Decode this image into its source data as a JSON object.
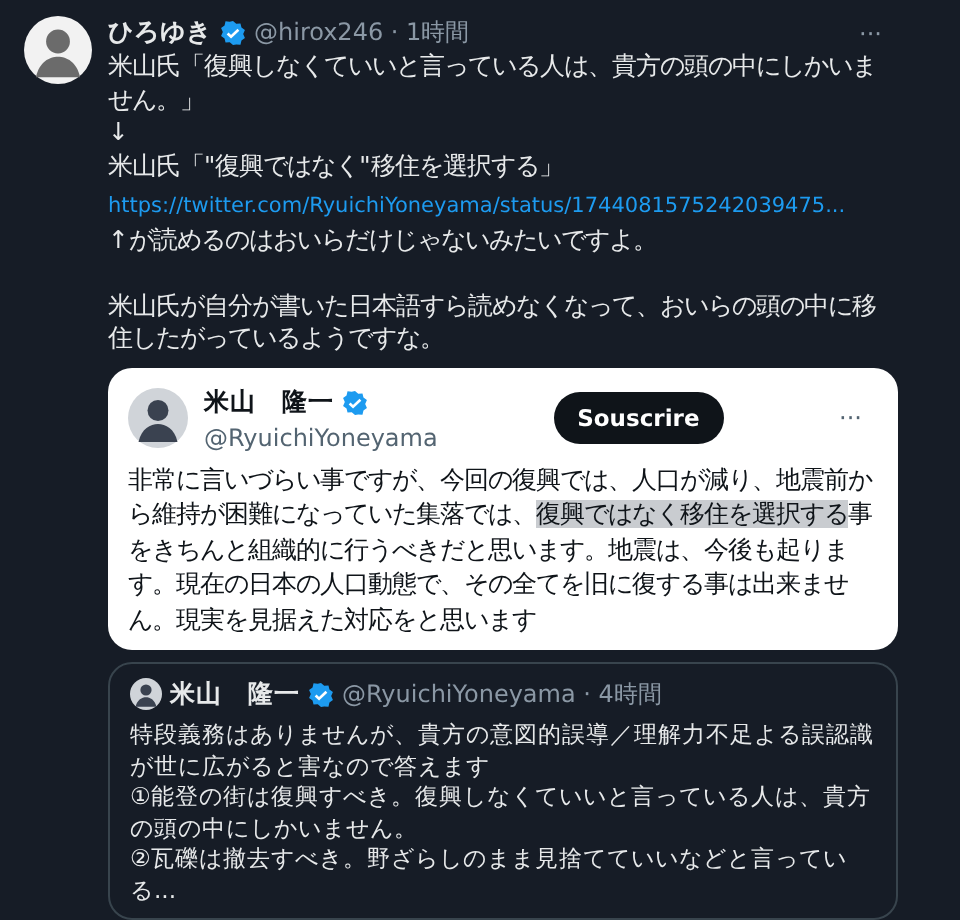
{
  "tweet": {
    "author": "ひろゆき",
    "verified": true,
    "handle": "@hirox246 · 1時間",
    "more": "···",
    "lines": [
      {
        "kind": "text",
        "text": "米山氏「復興しなくていいと言っている人は、貴方の頭の中にしかいません。」"
      },
      {
        "kind": "text",
        "text": "↓"
      },
      {
        "kind": "text",
        "text": "米山氏「\"復興ではなく\"移住を選択する」"
      },
      {
        "kind": "link",
        "text": "https://twitter.com/RyuichiYoneyama/status/1744081575242039475..."
      },
      {
        "kind": "text",
        "text": "↑が読めるのはおいらだけじゃないみたいですよ。"
      },
      {
        "kind": "blank"
      },
      {
        "kind": "text",
        "text": "米山氏が自分が書いた日本語すら読めなくなって、おいらの頭の中に移住したがっているようですな。"
      }
    ]
  },
  "embedded_post": {
    "author": "米山　隆一",
    "verified": true,
    "handle": "@RyuichiYoneyama",
    "button": "Souscrire",
    "more": "···",
    "segments": [
      {
        "text": "非常に言いづらい事ですが、今回の復興では、人口が減り、地震前から維持が困難になっていた集落では、",
        "highlighted": false
      },
      {
        "text": "復興ではなく移住を選択する",
        "highlighted": true
      },
      {
        "text": "事をきちんと組織的に行うべきだと思います。地震は、今後も起ります。現在の日本の人口動態で、その全てを旧に復する事は出来ません。現実を見据えた対応をと思います",
        "highlighted": false
      }
    ]
  },
  "quoted_post": {
    "author": "米山　隆一",
    "verified": true,
    "handle": "@RyuichiYoneyama · 4時間",
    "lines": [
      "特段義務はありませんが、貴方の意図的誤導／理解力不足よる誤認識が世に広がると害なので答えます",
      "①能登の街は復興すべき。復興しなくていいと言っている人は、貴方の頭の中にしかいません。",
      "②瓦礫は撤去すべき。野ざらしのまま見捨てていいなどと言っている..."
    ]
  }
}
